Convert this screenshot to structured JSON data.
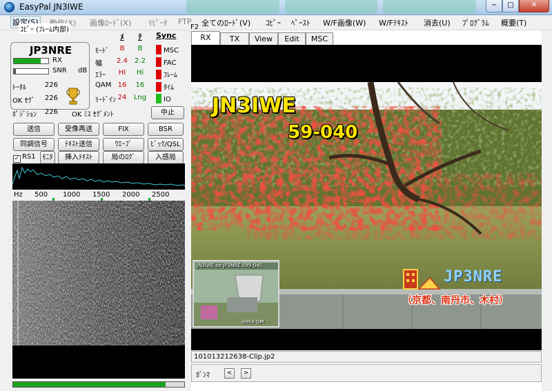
{
  "window": {
    "title": "EasyPal  JN3IWE",
    "minimize_glyph": "−",
    "maximize_glyph": "□",
    "close_glyph": "✕"
  },
  "menu": [
    {
      "label": "設定(S)",
      "style": "first"
    },
    {
      "label": "動作(X)",
      "style": "faded"
    },
    {
      "label": "画像ﾛｰﾄﾞ(X)",
      "style": "faded"
    },
    {
      "label": "ﾘﾋﾟｰﾀ",
      "style": "faded"
    },
    {
      "label": "FTP",
      "style": "faded"
    },
    {
      "label": "全てのﾛｰﾄﾞ(V)",
      "style": "normal"
    },
    {
      "label": "ｺﾋﾟｰ",
      "style": "normal"
    },
    {
      "label": "ﾍﾟｰｽﾄ",
      "style": "normal"
    },
    {
      "label": "W/F画像(W)",
      "style": "normal"
    },
    {
      "label": "W/Fﾃｷｽﾄ",
      "style": "normal"
    },
    {
      "label": "消去(U)",
      "style": "normal"
    },
    {
      "label": "ﾌﾟﾛｸﾞﾗﾑ",
      "style": "normal"
    },
    {
      "label": "概要(T)",
      "style": "normal"
    }
  ],
  "tooltip": "ｺﾋﾟｰ (ﾌﾚｰﾑ内部)",
  "f2_label": "F2",
  "status": {
    "callsign": "JP3NRE",
    "rx_label": "RX",
    "snr_label": "SNR",
    "db_label": "dB",
    "rx_level": 0.78,
    "snr_level": 0.05,
    "stats": [
      {
        "label": "ﾄｰﾀﾙ",
        "value": "226"
      },
      {
        "label": "OK ｾｸﾞ",
        "value": "226"
      },
      {
        "label": "ﾎﾟｼﾞｼｮﾝ",
        "value": "226"
      }
    ],
    "ok_miss_label": "OK ﾐｽ ｾｸﾞﾒﾝﾄ",
    "trophy_icon": "trophy-icon"
  },
  "qos": {
    "col_left": "ﾒ",
    "col_right": "ﾃ",
    "rows": [
      {
        "label": "ﾓｰﾄﾞ",
        "left": "B",
        "right": "B"
      },
      {
        "label": "幅",
        "left": "2.4",
        "right": "2.2"
      },
      {
        "label": "ｴﾗｰ",
        "left": "HI",
        "right": "Hi"
      },
      {
        "label": "QAM",
        "left": "16",
        "right": "16"
      },
      {
        "label": "ﾘｰﾄﾞｲﾝ",
        "left": "24",
        "right": "Lng"
      }
    ],
    "left_color": "#c00000",
    "right_color": "#008000"
  },
  "sync": {
    "title": "Sync",
    "items": [
      {
        "label": "MSC",
        "color": "#e00000"
      },
      {
        "label": "FAC",
        "color": "#e00000"
      },
      {
        "label": "ﾌﾚｰﾑ",
        "color": "#e00000"
      },
      {
        "label": "ﾀｲﾑ",
        "color": "#e00000"
      },
      {
        "label": "IO",
        "color": "#20c020"
      }
    ]
  },
  "buttons": {
    "stop": "中止",
    "send": "送信",
    "resend": "受像再送",
    "fix": "FIX",
    "bsr": "BSR",
    "sync_signal": "同調信号",
    "text_send": "ﾃｷｽﾄ送信",
    "wave": "ｳｴｰﾌﾞ",
    "pic_qsl": "ﾋﾞｯｸ/QSL",
    "rs1": "RS1",
    "monitor": "ﾓﾆﾀ",
    "insert_text": "挿入ﾃｷｽﾄ",
    "station_log": "局のﾛｸﾞ",
    "intruder": "入感局"
  },
  "rs1_checked": true,
  "freq_scale": {
    "unit": "Hz",
    "ticks": [
      "500",
      "1000",
      "1500",
      "2000",
      "2500"
    ]
  },
  "decode_progress": 0.89,
  "tabs": [
    "RX",
    "TX",
    "View",
    "Edit",
    "MSC"
  ],
  "active_tab": "RX",
  "image": {
    "callsign_overlay": "JN3IWE",
    "report_overlay": "59-040",
    "logo_text": "JP3NRE",
    "location_text": "（京都、南丹市、木村）",
    "inset_top_text": "JN3IWE   de  JP3NRE  599-040",
    "inset_bottom_text": "Hello GM"
  },
  "filename": "101013212638-Clip.jp2",
  "gamma": {
    "label": "ｶﾞﾝﾏ",
    "prev": "<",
    "next": ">"
  }
}
